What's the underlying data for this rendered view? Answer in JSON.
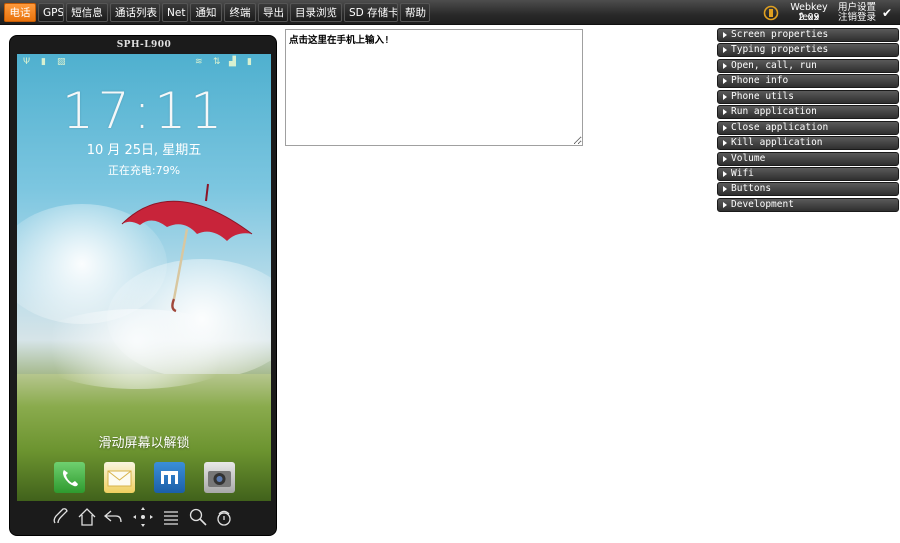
{
  "topbar": {
    "tabs": [
      {
        "label": "电话",
        "active": true
      },
      {
        "label": "GPS"
      },
      {
        "label": "短信息"
      },
      {
        "label": "通话列表"
      },
      {
        "label": "Net"
      },
      {
        "label": "通知"
      },
      {
        "label": "终端"
      },
      {
        "label": "导出"
      },
      {
        "label": "目录浏览"
      },
      {
        "label": "SD 存储卡"
      },
      {
        "label": "帮助"
      }
    ],
    "brand": {
      "version": "Webkey 2.09",
      "user": "fexx",
      "user_settings": "用户设置",
      "logout": "注销登录",
      "check_icon": "checkmark-icon"
    }
  },
  "phone": {
    "model": "SPH-L900",
    "clock": "17:11",
    "date": "10 月 25日, 星期五",
    "charging": "正在充电:79%",
    "unlock_hint": "滑动屏幕以解锁",
    "apps": [
      "phone-app-icon",
      "messages-app-icon",
      "maxthon-app-icon",
      "camera-app-icon"
    ],
    "nav_buttons": [
      "call-button",
      "home-button",
      "back-button",
      "dpad-button",
      "menu-button",
      "search-button",
      "end-call-button"
    ]
  },
  "input": {
    "placeholder": "点击这里在手机上输入!"
  },
  "menu": {
    "items": [
      "Screen properties",
      "Typing properties",
      "Open, call, run",
      "Phone info",
      "Phone utils",
      "Run application",
      "Close application",
      "Kill application",
      "Volume",
      "Wifi",
      "Buttons",
      "Development"
    ]
  },
  "colors": {
    "active_tab": "#f0821a",
    "topbar": "#2f2f2f",
    "menu_bg": "#3c3c3c"
  }
}
